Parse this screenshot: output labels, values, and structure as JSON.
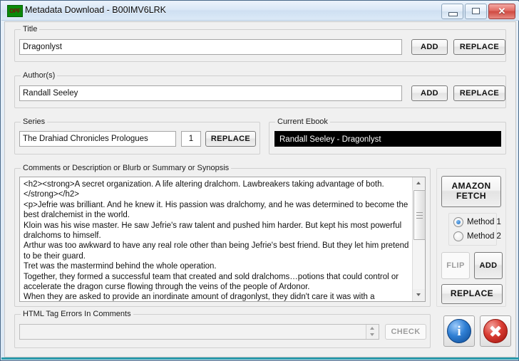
{
  "window": {
    "app_icon": "opf-icon",
    "icon_text": "OPF",
    "title": "Metadata Download - B00IMV6LRK",
    "controls": {
      "minimize": "minimize-icon",
      "maximize": "maximize-icon",
      "close": "✕"
    },
    "accent_color": "#2a9aab",
    "titlebar_color": "#d9e7f6",
    "background_color": "#f0f0f0"
  },
  "title_group": {
    "label": "Title",
    "value": "Dragonlyst",
    "placeholder": "",
    "add_label": "ADD",
    "replace_label": "REPLACE"
  },
  "author_group": {
    "label": "Author(s)",
    "value": "Randall Seeley",
    "placeholder": "",
    "add_label": "ADD",
    "replace_label": "REPLACE"
  },
  "series_group": {
    "label": "Series",
    "value": "The Drahiad Chronicles Prologues",
    "index_value": "1",
    "replace_label": "REPLACE"
  },
  "current_ebook_group": {
    "label": "Current Ebook",
    "value": "Randall Seeley - Dragonlyst",
    "text_color": "#ffffff",
    "background_color": "#000000"
  },
  "comments_group": {
    "label": "Comments or Description or Blurb or Summary or Synopsis",
    "value": "<h2><strong>A secret organization. A life altering dralchom. Lawbreakers taking advantage of both.</strong></h2>\n<p>Jefrie was brilliant. And he knew it. His passion was dralchomy, and he was determined to become the best dralchemist in the world.\nKloin was his wise master. He saw Jefrie's raw talent and pushed him harder. But kept his most powerful dralchoms to himself.\nArthur was too awkward to have any real role other than being Jefrie's best friend. But they let him pretend to be their guard.\nTret was the mastermind behind the whole operation.\nTogether, they formed a successful team that created and sold dralchoms…potions that could control or accelerate the dragon curse flowing through the veins of the people of Ardonor.\nWhen they are asked to provide an inordinate amount of dragonlyst, they didn't care it was with a mysterious organization that participated in dark rituals and sacrifices. All they cared about was the massive gold being offered"
  },
  "fetch_panel": {
    "amazon_fetch_label": "AMAZON\nFETCH",
    "amazon_fetch_line1": "AMAZON",
    "amazon_fetch_line2": "FETCH",
    "methods": [
      {
        "label": "Method 1",
        "selected": true
      },
      {
        "label": "Method 2",
        "selected": false
      }
    ],
    "flip_label": "FLIP",
    "flip_disabled": true,
    "add_label": "ADD",
    "replace_label": "REPLACE"
  },
  "html_errors_group": {
    "label": "HTML Tag Errors In Comments",
    "value": "",
    "check_label": "CHECK",
    "check_disabled": true
  },
  "action_icons": {
    "info": {
      "name": "info-icon",
      "glyph": "i",
      "color": "#2f7fd4"
    },
    "cancel": {
      "name": "cancel-icon",
      "glyph": "✕",
      "color": "#d93c32"
    }
  }
}
